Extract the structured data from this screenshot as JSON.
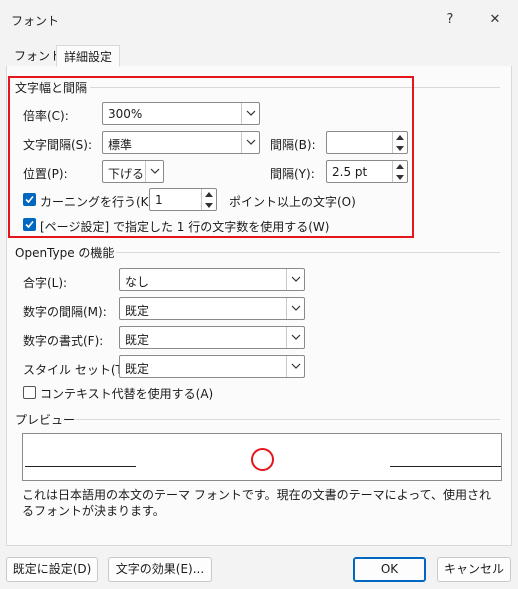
{
  "window": {
    "title": "フォント",
    "help": "?",
    "close": "✕"
  },
  "tabs": [
    {
      "label": "フォント"
    },
    {
      "label": "詳細設定"
    }
  ],
  "spacing": {
    "group_title": "文字幅と間隔",
    "scale": {
      "label": "倍率(C):",
      "value": "300%"
    },
    "spacing": {
      "label": "文字間隔(S):",
      "value": "標準"
    },
    "spacing_by": {
      "label": "間隔(B):",
      "value": ""
    },
    "position": {
      "label": "位置(P):",
      "value": "下げる"
    },
    "position_by": {
      "label": "間隔(Y):",
      "value": "2.5 pt"
    },
    "kerning": {
      "label": "カーニングを行う(K):",
      "checked": true,
      "value": "1",
      "suffix": "ポイント以上の文字(O)"
    },
    "grid": {
      "label": "[ページ設定] で指定した 1 行の文字数を使用する(W)",
      "checked": true
    }
  },
  "opentype": {
    "group_title": "OpenType の機能",
    "ligatures": {
      "label": "合字(L):",
      "value": "なし"
    },
    "number_spacing": {
      "label": "数字の間隔(M):",
      "value": "既定"
    },
    "number_forms": {
      "label": "数字の書式(F):",
      "value": "既定"
    },
    "stylistic_sets": {
      "label": "スタイル セット(T):",
      "value": "既定"
    },
    "contextual": {
      "label": "コンテキスト代替を使用する(A)",
      "checked": false
    }
  },
  "preview": {
    "group_title": "プレビュー",
    "description": "これは日本語用の本文のテーマ フォントです。現在の文書のテーマによって、使用されるフォントが決まります。"
  },
  "buttons": {
    "set_default": "既定に設定(D)",
    "text_effects": "文字の効果(E)...",
    "ok": "OK",
    "cancel": "キャンセル"
  },
  "colors": {
    "accent": "#0067c0",
    "highlight": "#e4161c",
    "preview_circle": "#e4161c"
  }
}
